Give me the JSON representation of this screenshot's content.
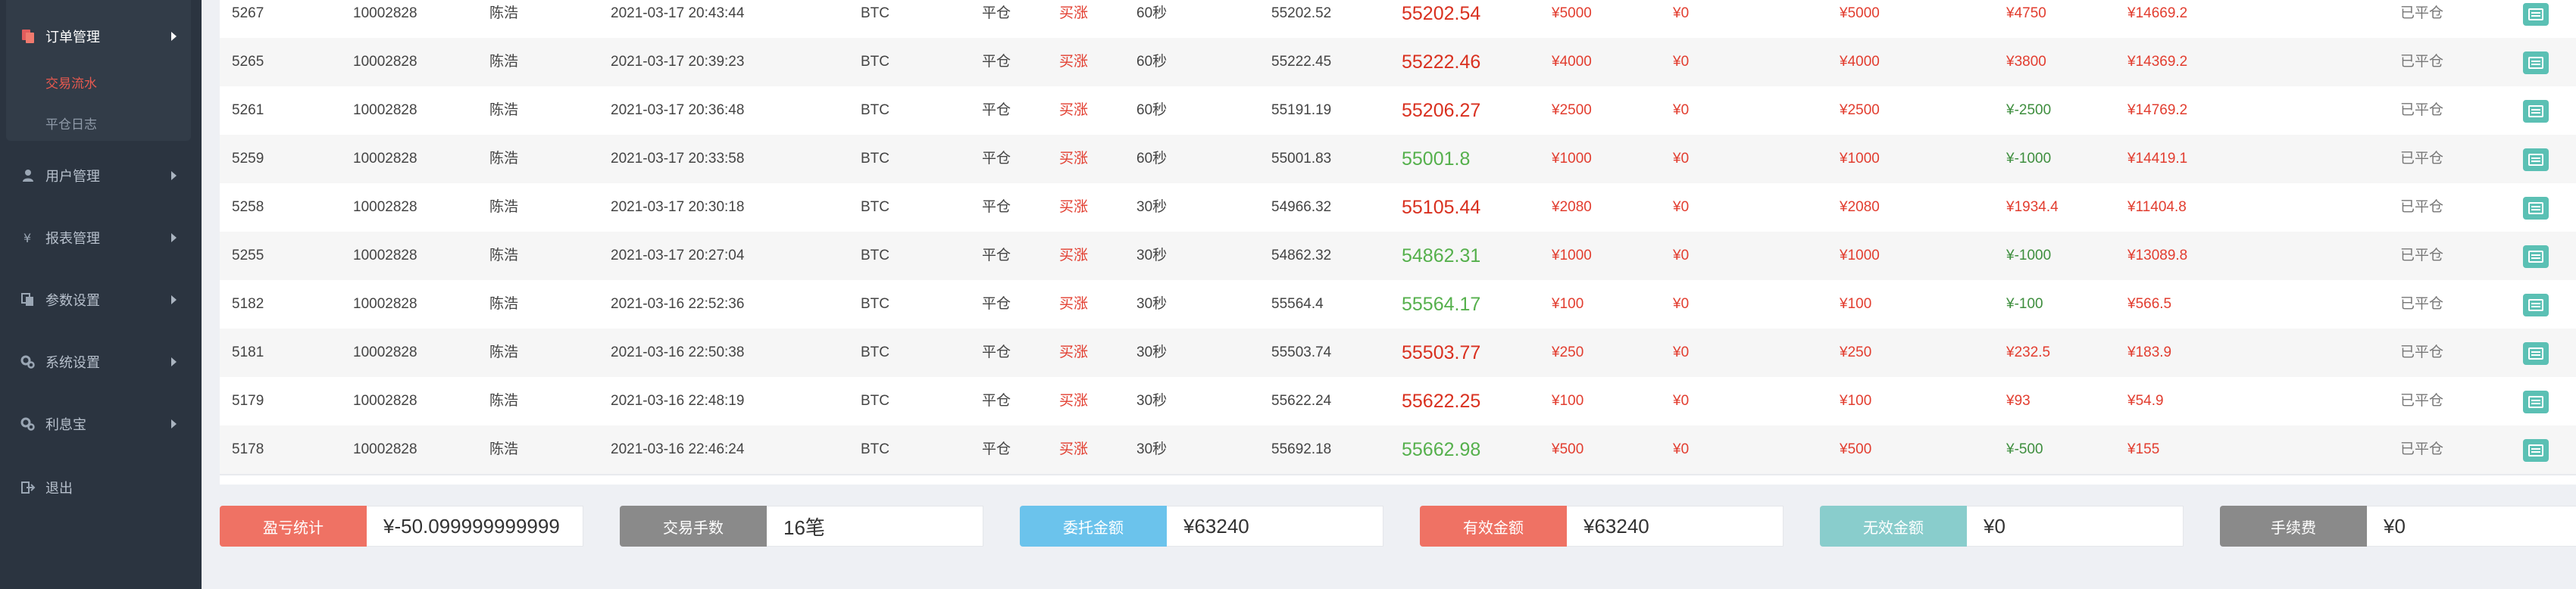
{
  "sidebar": {
    "items": [
      {
        "label": "订单管理",
        "icon": "order-icon",
        "active": true
      },
      {
        "label": "用户管理",
        "icon": "user-icon"
      },
      {
        "label": "报表管理",
        "icon": "yen-icon"
      },
      {
        "label": "参数设置",
        "icon": "copy-icon"
      },
      {
        "label": "系统设置",
        "icon": "gears-icon"
      },
      {
        "label": "利息宝",
        "icon": "gears-icon"
      },
      {
        "label": "退出",
        "icon": "logout-icon"
      }
    ],
    "sub_items": [
      {
        "label": "交易流水",
        "active": true
      },
      {
        "label": "平仓日志"
      }
    ]
  },
  "table": {
    "rows": [
      {
        "id": "5267",
        "uid": "10002828",
        "name": "陈浩",
        "time": "2021-03-17 20:43:44",
        "coin": "BTC",
        "type": "平仓",
        "direction": "买涨",
        "period": "60秒",
        "open_price": "55202.52",
        "close_price": "55202.54",
        "close_color": "red",
        "amount": "¥5000",
        "fee": "¥0",
        "valid": "¥5000",
        "profit": "¥4750",
        "profit_color": "red",
        "balance": "¥14669.2",
        "status": "已平仓"
      },
      {
        "id": "5265",
        "uid": "10002828",
        "name": "陈浩",
        "time": "2021-03-17 20:39:23",
        "coin": "BTC",
        "type": "平仓",
        "direction": "买涨",
        "period": "60秒",
        "open_price": "55222.45",
        "close_price": "55222.46",
        "close_color": "red",
        "amount": "¥4000",
        "fee": "¥0",
        "valid": "¥4000",
        "profit": "¥3800",
        "profit_color": "red",
        "balance": "¥14369.2",
        "status": "已平仓"
      },
      {
        "id": "5261",
        "uid": "10002828",
        "name": "陈浩",
        "time": "2021-03-17 20:36:48",
        "coin": "BTC",
        "type": "平仓",
        "direction": "买涨",
        "period": "60秒",
        "open_price": "55191.19",
        "close_price": "55206.27",
        "close_color": "red",
        "amount": "¥2500",
        "fee": "¥0",
        "valid": "¥2500",
        "profit": "¥-2500",
        "profit_color": "green",
        "balance": "¥14769.2",
        "status": "已平仓"
      },
      {
        "id": "5259",
        "uid": "10002828",
        "name": "陈浩",
        "time": "2021-03-17 20:33:58",
        "coin": "BTC",
        "type": "平仓",
        "direction": "买涨",
        "period": "60秒",
        "open_price": "55001.83",
        "close_price": "55001.8",
        "close_color": "green",
        "amount": "¥1000",
        "fee": "¥0",
        "valid": "¥1000",
        "profit": "¥-1000",
        "profit_color": "green",
        "balance": "¥14419.1",
        "status": "已平仓"
      },
      {
        "id": "5258",
        "uid": "10002828",
        "name": "陈浩",
        "time": "2021-03-17 20:30:18",
        "coin": "BTC",
        "type": "平仓",
        "direction": "买涨",
        "period": "30秒",
        "open_price": "54966.32",
        "close_price": "55105.44",
        "close_color": "red",
        "amount": "¥2080",
        "fee": "¥0",
        "valid": "¥2080",
        "profit": "¥1934.4",
        "profit_color": "red",
        "balance": "¥11404.8",
        "status": "已平仓"
      },
      {
        "id": "5255",
        "uid": "10002828",
        "name": "陈浩",
        "time": "2021-03-17 20:27:04",
        "coin": "BTC",
        "type": "平仓",
        "direction": "买涨",
        "period": "30秒",
        "open_price": "54862.32",
        "close_price": "54862.31",
        "close_color": "green",
        "amount": "¥1000",
        "fee": "¥0",
        "valid": "¥1000",
        "profit": "¥-1000",
        "profit_color": "green",
        "balance": "¥13089.8",
        "status": "已平仓"
      },
      {
        "id": "5182",
        "uid": "10002828",
        "name": "陈浩",
        "time": "2021-03-16 22:52:36",
        "coin": "BTC",
        "type": "平仓",
        "direction": "买涨",
        "period": "30秒",
        "open_price": "55564.4",
        "close_price": "55564.17",
        "close_color": "green",
        "amount": "¥100",
        "fee": "¥0",
        "valid": "¥100",
        "profit": "¥-100",
        "profit_color": "green",
        "balance": "¥566.5",
        "status": "已平仓"
      },
      {
        "id": "5181",
        "uid": "10002828",
        "name": "陈浩",
        "time": "2021-03-16 22:50:38",
        "coin": "BTC",
        "type": "平仓",
        "direction": "买涨",
        "period": "30秒",
        "open_price": "55503.74",
        "close_price": "55503.77",
        "close_color": "red",
        "amount": "¥250",
        "fee": "¥0",
        "valid": "¥250",
        "profit": "¥232.5",
        "profit_color": "red",
        "balance": "¥183.9",
        "status": "已平仓"
      },
      {
        "id": "5179",
        "uid": "10002828",
        "name": "陈浩",
        "time": "2021-03-16 22:48:19",
        "coin": "BTC",
        "type": "平仓",
        "direction": "买涨",
        "period": "30秒",
        "open_price": "55622.24",
        "close_price": "55622.25",
        "close_color": "red",
        "amount": "¥100",
        "fee": "¥0",
        "valid": "¥100",
        "profit": "¥93",
        "profit_color": "red",
        "balance": "¥54.9",
        "status": "已平仓"
      },
      {
        "id": "5178",
        "uid": "10002828",
        "name": "陈浩",
        "time": "2021-03-16 22:46:24",
        "coin": "BTC",
        "type": "平仓",
        "direction": "买涨",
        "period": "30秒",
        "open_price": "55692.18",
        "close_price": "55662.98",
        "close_color": "green",
        "amount": "¥500",
        "fee": "¥0",
        "valid": "¥500",
        "profit": "¥-500",
        "profit_color": "green",
        "balance": "¥155",
        "status": "已平仓"
      }
    ],
    "action_icon": "detail-icon"
  },
  "stats": [
    {
      "label": "盈亏统计",
      "value": "¥-50.099999999999",
      "color": "#ef7264"
    },
    {
      "label": "交易手数",
      "value": "16笔",
      "color": "#8a8a8a"
    },
    {
      "label": "委托金额",
      "value": "¥63240",
      "color": "#6bc3ec"
    },
    {
      "label": "有效金额",
      "value": "¥63240",
      "color": "#ef7264"
    },
    {
      "label": "无效金额",
      "value": "¥0",
      "color": "#89cdcc"
    },
    {
      "label": "手续费",
      "value": "¥0",
      "color": "#8a8a8a"
    }
  ],
  "colors": {
    "sidebar_bg": "#2b3440",
    "red": "#e23d2f",
    "green": "#3e8e3e",
    "action": "#5bc0b4"
  }
}
